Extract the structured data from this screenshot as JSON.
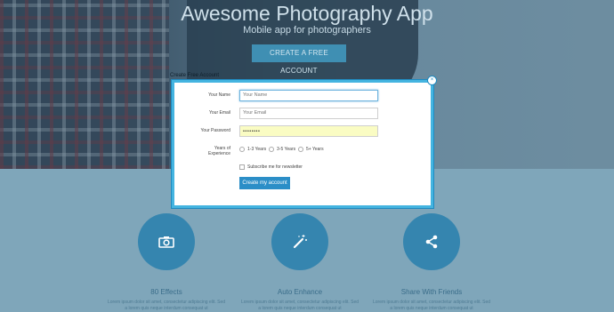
{
  "hero": {
    "title": "Awesome Photography App",
    "subtitle": "Mobile app for photographers",
    "cta_label": "CREATE A FREE ACCOUNT"
  },
  "modal": {
    "title": "Create Free Account",
    "close_symbol": "×",
    "name_label": "Your Name",
    "name_placeholder": "Your Name",
    "email_label": "Your Email",
    "email_placeholder": "Your Email",
    "password_label": "Your Password",
    "password_value": "••••••••",
    "years_label_line1": "Years of",
    "years_label_line2": "Experience",
    "years_options": [
      "1-3 Years",
      "3-5 Years",
      "5+ Years"
    ],
    "newsletter_label": "Subscribe me for newsletter",
    "submit_label": "Create my account"
  },
  "features": [
    {
      "title": "80 Effects",
      "icon": "camera-icon",
      "body": "Lorem ipsum dolor sit amet, consectetur adipiscing elit. Sed a lorem quis neque interdum consequat ut"
    },
    {
      "title": "Auto Enhance",
      "icon": "magic-wand-icon",
      "body": "Lorem ipsum dolor sit amet, consectetur adipiscing elit. Sed a lorem quis neque interdum consequat ut"
    },
    {
      "title": "Share With Friends",
      "icon": "share-icon",
      "body": "Lorem ipsum dolor sit amet, consectetur adipiscing elit. Sed a lorem quis neque interdum consequat ut"
    }
  ],
  "colors": {
    "accent": "#2b8ec7",
    "modal_border": "#44b4e0",
    "feature_circle": "#3585af",
    "page_background": "#7fa6ba"
  }
}
